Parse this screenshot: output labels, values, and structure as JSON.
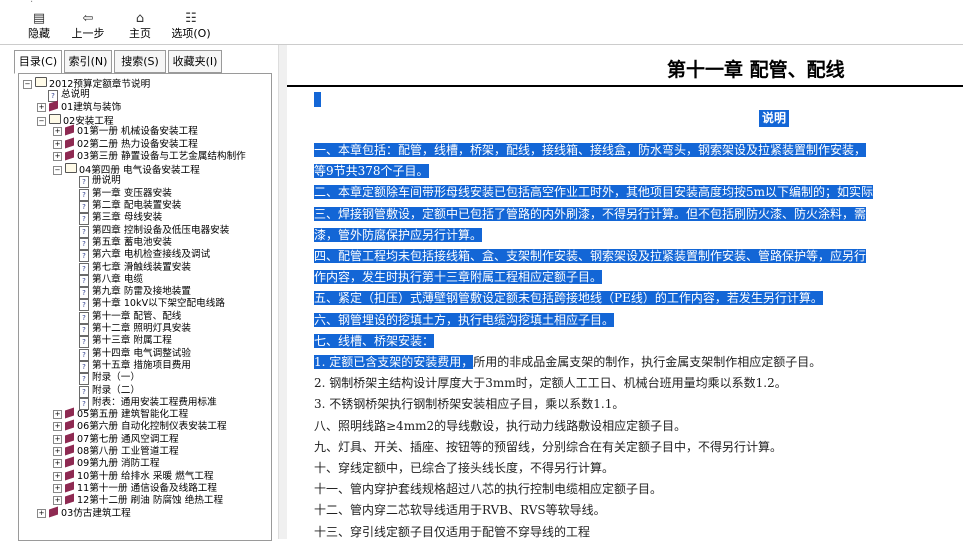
{
  "toolbar": {
    "hide": "隐藏",
    "back": "上一步",
    "home": "主页",
    "options": "选项(O)"
  },
  "tabs": [
    "目录(C)",
    "索引(N)",
    "搜索(S)",
    "收藏夹(I)"
  ],
  "tree": [
    {
      "expander": "-",
      "icon": "book-open",
      "label": "2012预算定额章节说明",
      "level": 0
    },
    {
      "expander": "",
      "icon": "page",
      "label": "总说明",
      "level": 1
    },
    {
      "expander": "+",
      "icon": "book-closed",
      "label": "01建筑与装饰",
      "level": 1
    },
    {
      "expander": "-",
      "icon": "book-open",
      "label": "02安装工程",
      "level": 1
    },
    {
      "expander": "+",
      "icon": "book-closed",
      "label": "01第一册 机械设备安装工程",
      "level": 2
    },
    {
      "expander": "+",
      "icon": "book-closed",
      "label": "02第二册 热力设备安装工程",
      "level": 2
    },
    {
      "expander": "+",
      "icon": "book-closed",
      "label": "03第三册 静置设备与工艺金属结构制作",
      "level": 2
    },
    {
      "expander": "-",
      "icon": "book-open",
      "label": "04第四册 电气设备安装工程",
      "level": 2
    },
    {
      "expander": "",
      "icon": "page",
      "label": "册说明",
      "level": 3
    },
    {
      "expander": "",
      "icon": "page",
      "label": "第一章 变压器安装",
      "level": 3
    },
    {
      "expander": "",
      "icon": "page",
      "label": "第二章 配电装置安装",
      "level": 3
    },
    {
      "expander": "",
      "icon": "page",
      "label": "第三章 母线安装",
      "level": 3
    },
    {
      "expander": "",
      "icon": "page",
      "label": "第四章 控制设备及低压电器安装",
      "level": 3
    },
    {
      "expander": "",
      "icon": "page",
      "label": "第五章 蓄电池安装",
      "level": 3
    },
    {
      "expander": "",
      "icon": "page",
      "label": "第六章 电机检查接线及调试",
      "level": 3
    },
    {
      "expander": "",
      "icon": "page",
      "label": "第七章 滑触线装置安装",
      "level": 3
    },
    {
      "expander": "",
      "icon": "page",
      "label": "第八章 电缆",
      "level": 3
    },
    {
      "expander": "",
      "icon": "page",
      "label": "第九章 防雷及接地装置",
      "level": 3
    },
    {
      "expander": "",
      "icon": "page",
      "label": "第十章 10kV以下架空配电线路",
      "level": 3
    },
    {
      "expander": "",
      "icon": "page",
      "label": "第十一章 配管、配线",
      "level": 3
    },
    {
      "expander": "",
      "icon": "page",
      "label": "第十二章 照明灯具安装",
      "level": 3
    },
    {
      "expander": "",
      "icon": "page",
      "label": "第十三章 附属工程",
      "level": 3
    },
    {
      "expander": "",
      "icon": "page",
      "label": "第十四章 电气调整试验",
      "level": 3
    },
    {
      "expander": "",
      "icon": "page",
      "label": "第十五章 措施项目费用",
      "level": 3
    },
    {
      "expander": "",
      "icon": "page",
      "label": "附录（一）",
      "level": 3
    },
    {
      "expander": "",
      "icon": "page",
      "label": "附录（二）",
      "level": 3
    },
    {
      "expander": "",
      "icon": "page",
      "label": "附表：通用安装工程费用标准",
      "level": 3
    },
    {
      "expander": "+",
      "icon": "book-closed",
      "label": "05第五册 建筑智能化工程",
      "level": 2
    },
    {
      "expander": "+",
      "icon": "book-closed",
      "label": "06第六册 自动化控制仪表安装工程",
      "level": 2
    },
    {
      "expander": "+",
      "icon": "book-closed",
      "label": "07第七册 通风空调工程",
      "level": 2
    },
    {
      "expander": "+",
      "icon": "book-closed",
      "label": "08第八册 工业管道工程",
      "level": 2
    },
    {
      "expander": "+",
      "icon": "book-closed",
      "label": "09第九册 消防工程",
      "level": 2
    },
    {
      "expander": "+",
      "icon": "book-closed",
      "label": "10第十册 给排水 采暖 燃气工程",
      "level": 2
    },
    {
      "expander": "+",
      "icon": "book-closed",
      "label": "11第十一册 通信设备及线路工程",
      "level": 2
    },
    {
      "expander": "+",
      "icon": "book-closed",
      "label": "12第十二册 刷油 防腐蚀 绝热工程",
      "level": 2
    },
    {
      "expander": "+",
      "icon": "book-closed",
      "label": "03仿古建筑工程",
      "level": 1
    }
  ],
  "content": {
    "chapter_title": "第十一章 配管、配线",
    "section_heading": "说明",
    "lines": [
      {
        "text": "一、本章包括：配管，线槽，桥架，配线，接线箱、接线盒，防水弯头，钢索架设及拉紧装置制作安装，",
        "hl": "all"
      },
      {
        "text": "等9节共378个子目。",
        "hl": "all"
      },
      {
        "text": "二、本章定额除车间带形母线安装已包括高空作业工时外，其他项目安装高度均按5m以下编制的；如实际",
        "hl": "all"
      },
      {
        "text": "三、焊接钢管敷设，定额中已包括了管路的内外刷漆，不得另行计算。但不包括刷防火漆、防火涂料，需",
        "hl": "all"
      },
      {
        "text": "漆，管外防腐保护应另行计算。",
        "hl": "all"
      },
      {
        "text": "四、配管工程均未包括接线箱、盒、支架制作安装、钢索架设及拉紧装置制作安装、管路保护等，应另行",
        "hl": "all"
      },
      {
        "text": "作内容，发生时执行第十三章附属工程相应定额子目。",
        "hl": "all"
      },
      {
        "text": "五、紧定（扣压）式薄壁钢管敷设定额未包括跨接地线（PE线）的工作内容，若发生另行计算。",
        "hl": "all"
      },
      {
        "text": "六、钢管埋设的挖填土方，执行电缆沟挖填土相应子目。",
        "hl": "all"
      },
      {
        "text": "七、线槽、桥架安装：",
        "hl": "all"
      },
      {
        "text": "1. 定额已含支架的安装费用，所用的非成品金属支架的制作，执行金属支架制作相应定额子目。",
        "hl": "partial",
        "hl_text": "1. 定额已含支架的安装费用，",
        "rest": "所用的非成品金属支架的制作，执行金属支架制作相应定额子目。"
      },
      {
        "text": "2. 钢制桥架主结构设计厚度大于3mm时，定额人工工日、机械台班用量均乘以系数1.2。",
        "hl": "none"
      },
      {
        "text": "3. 不锈钢桥架执行钢制桥架安装相应子目，乘以系数1.1。",
        "hl": "none"
      },
      {
        "text": "八、照明线路≥4mm2的导线敷设，执行动力线路敷设相应定额子目。",
        "hl": "none"
      },
      {
        "text": "九、灯具、开关、插座、按钮等的预留线，分别综合在有关定额子目中，不得另行计算。",
        "hl": "none"
      },
      {
        "text": "十、穿线定额中，已综合了接头线长度，不得另行计算。",
        "hl": "none"
      },
      {
        "text": "十一、管内穿护套线规格超过八芯的执行控制电缆相应定额子目。",
        "hl": "none"
      },
      {
        "text": "十二、管内穿二芯软导线适用于RVB、RVS等软导线。",
        "hl": "none"
      },
      {
        "text": "十三、穿引线定额子目仅适用于配管不穿导线的工程",
        "hl": "none"
      }
    ]
  }
}
